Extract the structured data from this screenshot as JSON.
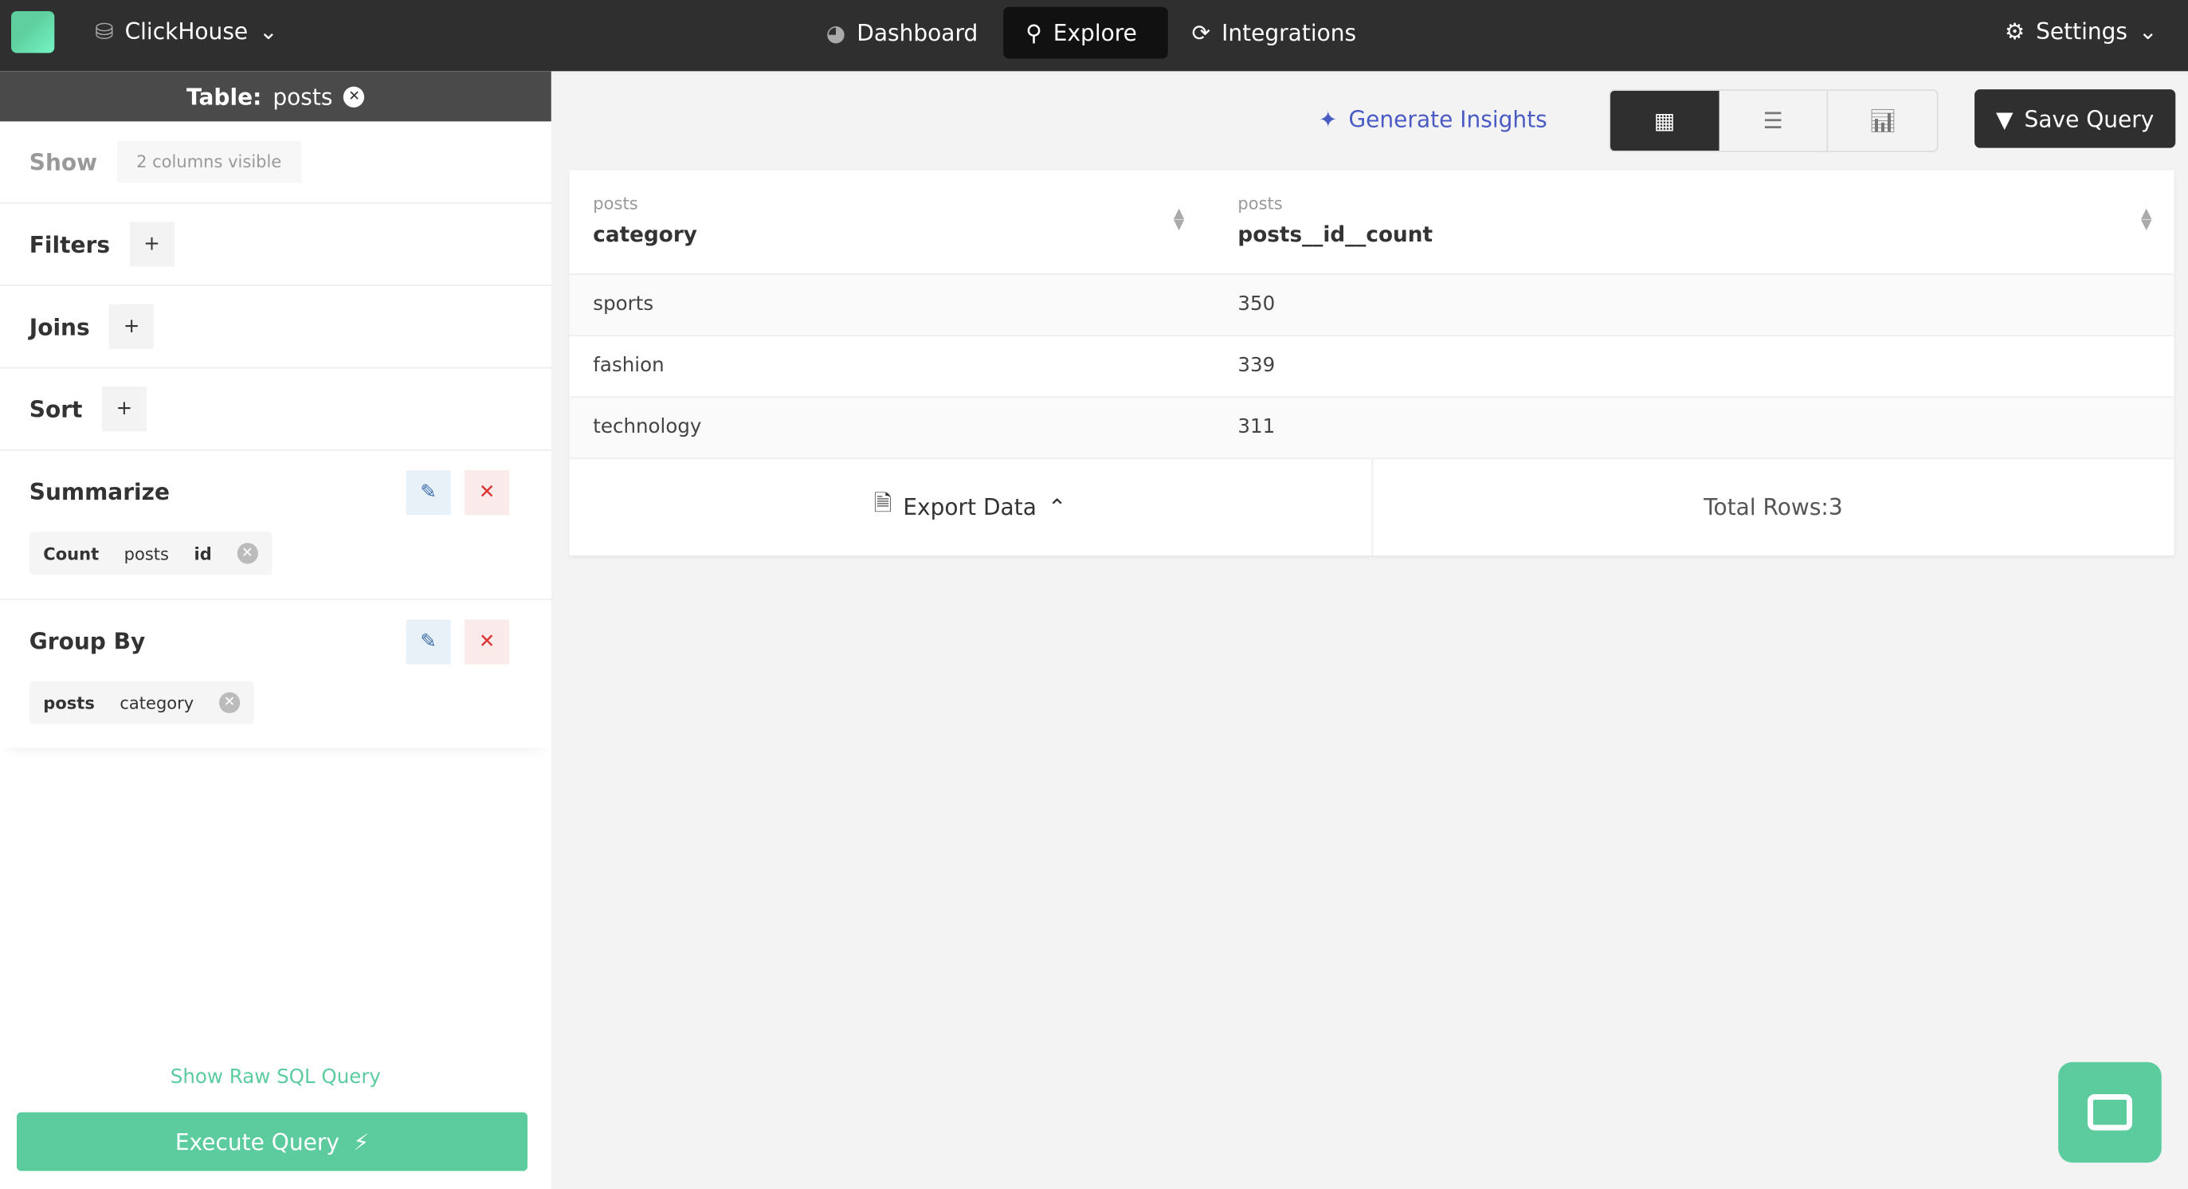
{
  "topbar": {
    "datasource": "ClickHouse",
    "nav": [
      {
        "label": "Dashboard",
        "icon": "dashboard-icon"
      },
      {
        "label": "Explore",
        "icon": "search-icon",
        "active": true
      },
      {
        "label": "Integrations",
        "icon": "refresh-icon"
      }
    ],
    "settings": "Settings"
  },
  "sidebar": {
    "table_label": "Table:",
    "table_name": "posts",
    "show_label": "Show",
    "show_value": "2 columns visible",
    "filters": "Filters",
    "joins": "Joins",
    "sort": "Sort",
    "summarize": "Summarize",
    "summarize_pill": {
      "agg": "Count",
      "table": "posts",
      "column": "id"
    },
    "group_by": "Group By",
    "group_pill": {
      "table": "posts",
      "column": "category"
    },
    "raw_sql": "Show Raw SQL Query",
    "execute": "Execute Query"
  },
  "toolbar": {
    "insights": "Generate Insights",
    "save": "Save Query",
    "views": [
      "table",
      "list",
      "chart"
    ],
    "active_view": "table"
  },
  "table": {
    "columns": [
      {
        "table": "posts",
        "name": "category"
      },
      {
        "table": "posts",
        "name": "posts__id__count"
      }
    ],
    "rows": [
      [
        "sports",
        "350"
      ],
      [
        "fashion",
        "339"
      ],
      [
        "technology",
        "311"
      ]
    ],
    "export": "Export Data",
    "total": "Total Rows:3"
  },
  "colors": {
    "accent": "#5ccc9f",
    "topbar": "#2f2f2f",
    "insights": "#4a5bc4"
  }
}
